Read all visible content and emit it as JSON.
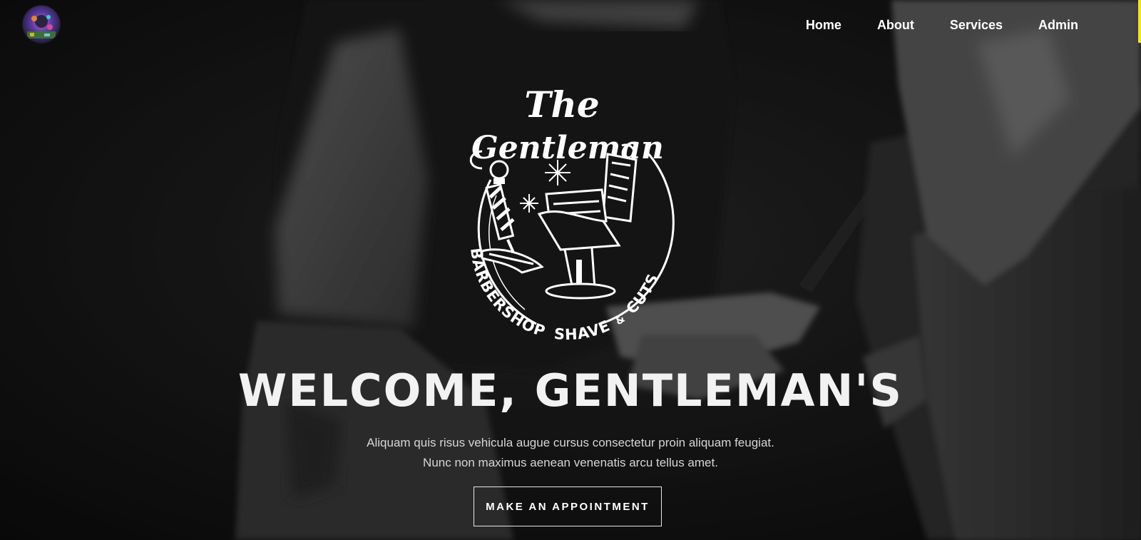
{
  "nav": {
    "logo_icon": "barbershop-avatar-logo",
    "items": [
      {
        "label": "Home"
      },
      {
        "label": "About"
      },
      {
        "label": "Services"
      },
      {
        "label": "Admin"
      }
    ]
  },
  "emblem": {
    "line1": "The",
    "line2": "Gentleman",
    "arc_left": "BARBERSHOP",
    "arc_right": "SHAVE",
    "ampersand": "&",
    "arc_end": "CUTS",
    "icons": [
      "barber-pole-icon",
      "barber-chair-icon",
      "sparkle-icon"
    ]
  },
  "hero": {
    "headline": "WELCOME, GENTLEMAN'S",
    "subtext_line1": "Aliquam quis risus vehicula augue cursus consectetur proin aliquam feugiat.",
    "subtext_line2": "Nunc non maximus aenean venenatis arcu tellus amet.",
    "cta_label": "MAKE AN APPOINTMENT"
  },
  "colors": {
    "background": "#161616",
    "text": "#ffffff",
    "accent": "#f3e51b"
  }
}
